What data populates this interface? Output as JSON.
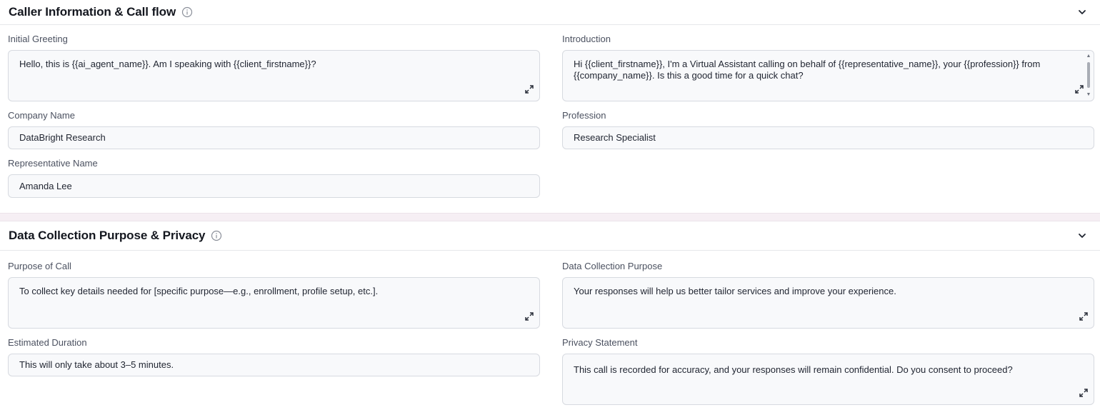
{
  "sections": [
    {
      "title": "Caller Information & Call flow",
      "fields": {
        "initial_greeting": {
          "label": "Initial Greeting",
          "value": "Hello, this is {{ai_agent_name}}. Am I speaking with {{client_firstname}}?"
        },
        "introduction": {
          "label": "Introduction",
          "value": "Hi {{client_firstname}}, I'm a Virtual Assistant calling on behalf of {{representative_name}}, your {{profession}} from {{company_name}}. Is this a good time for a quick chat?"
        },
        "company_name": {
          "label": "Company Name",
          "value": "DataBright Research"
        },
        "profession": {
          "label": "Profession",
          "value": "Research Specialist"
        },
        "representative_name": {
          "label": "Representative Name",
          "value": "Amanda Lee"
        }
      }
    },
    {
      "title": "Data Collection Purpose & Privacy",
      "fields": {
        "purpose_of_call": {
          "label": "Purpose of Call",
          "value": "To collect key details needed for [specific purpose—e.g., enrollment, profile setup, etc.]."
        },
        "data_collection_purpose": {
          "label": "Data Collection Purpose",
          "value": "Your responses will help us better tailor services and improve your experience."
        },
        "estimated_duration": {
          "label": "Estimated Duration",
          "value": "This will only take about 3–5 minutes."
        },
        "privacy_statement": {
          "label": "Privacy Statement",
          "value": "This call is recorded for accuracy, and your responses will remain confidential. Do you consent to proceed?"
        }
      }
    }
  ],
  "icons": {
    "info": "info-icon",
    "collapse": "chevron-down-icon",
    "expand": "expand-icon"
  },
  "colors": {
    "field_background": "#f8f9fb",
    "field_border": "#d7dae0",
    "divider_band": "#f6eff4"
  }
}
